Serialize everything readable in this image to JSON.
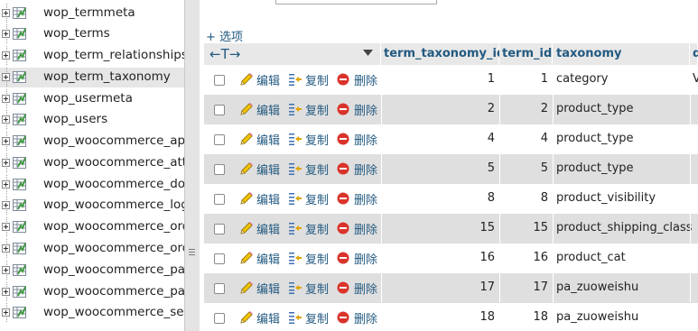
{
  "nav": {
    "tables": [
      {
        "name": "wop_termmeta",
        "selected": false
      },
      {
        "name": "wop_terms",
        "selected": false
      },
      {
        "name": "wop_term_relationships",
        "selected": false
      },
      {
        "name": "wop_term_taxonomy",
        "selected": true
      },
      {
        "name": "wop_usermeta",
        "selected": false
      },
      {
        "name": "wop_users",
        "selected": false
      },
      {
        "name": "wop_woocommerce_api_",
        "selected": false
      },
      {
        "name": "wop_woocommerce_attr",
        "selected": false
      },
      {
        "name": "wop_woocommerce_dow",
        "selected": false
      },
      {
        "name": "wop_woocommerce_log",
        "selected": false
      },
      {
        "name": "wop_woocommerce_ord",
        "selected": false
      },
      {
        "name": "wop_woocommerce_ord",
        "selected": false
      },
      {
        "name": "wop_woocommerce_pay",
        "selected": false
      },
      {
        "name": "wop_woocommerce_pay",
        "selected": false
      },
      {
        "name": "wop_woocommerce_sess",
        "selected": false
      }
    ]
  },
  "main": {
    "options_label": "+ 选项",
    "columns": {
      "arrows": "←T→",
      "term_taxonomy_id": "term_taxonomy_id",
      "term_id": "term_id",
      "taxonomy": "taxonomy",
      "next_partial": "d"
    },
    "actions": {
      "edit": "编辑",
      "copy": "复制",
      "delete": "删除"
    },
    "rows": [
      {
        "term_taxonomy_id": "1",
        "term_id": "1",
        "taxonomy": "category",
        "edge": "V"
      },
      {
        "term_taxonomy_id": "2",
        "term_id": "2",
        "taxonomy": "product_type",
        "edge": ""
      },
      {
        "term_taxonomy_id": "4",
        "term_id": "4",
        "taxonomy": "product_type",
        "edge": ""
      },
      {
        "term_taxonomy_id": "5",
        "term_id": "5",
        "taxonomy": "product_type",
        "edge": ""
      },
      {
        "term_taxonomy_id": "8",
        "term_id": "8",
        "taxonomy": "product_visibility",
        "edge": ""
      },
      {
        "term_taxonomy_id": "15",
        "term_id": "15",
        "taxonomy": "product_shipping_class",
        "edge": ""
      },
      {
        "term_taxonomy_id": "16",
        "term_id": "16",
        "taxonomy": "product_cat",
        "edge": ""
      },
      {
        "term_taxonomy_id": "17",
        "term_id": "17",
        "taxonomy": "pa_zuoweishu",
        "edge": ""
      },
      {
        "term_taxonomy_id": "18",
        "term_id": "18",
        "taxonomy": "pa_zuoweishu",
        "edge": ""
      }
    ]
  },
  "colors": {
    "link": "#235a81",
    "row_alt": "#dfdfdf",
    "header_bg": "#e8e8e8",
    "delete_red": "#d9342b"
  }
}
